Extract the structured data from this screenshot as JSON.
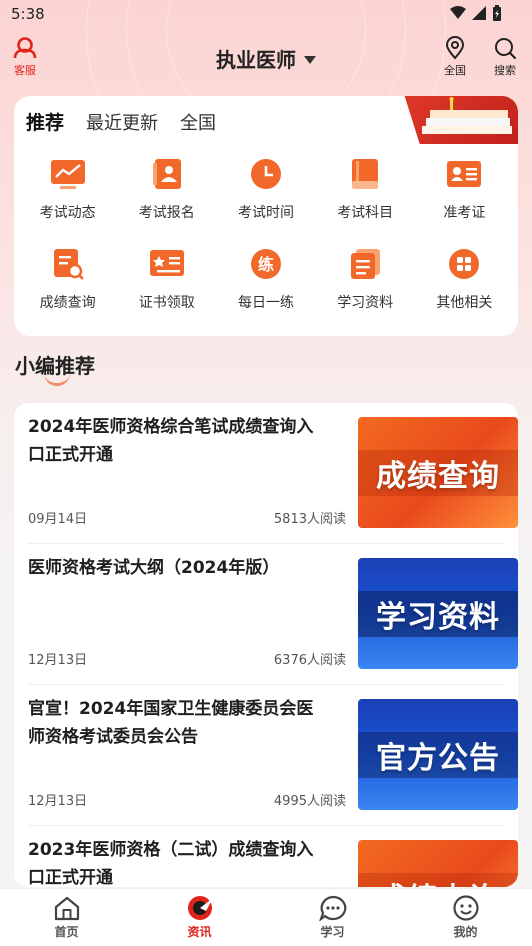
{
  "status_bar": {
    "time": "5:38"
  },
  "header": {
    "service_label": "客服",
    "title": "执业医师",
    "region_label": "全国",
    "search_label": "搜索"
  },
  "tabs": [
    {
      "label": "推荐",
      "active": true
    },
    {
      "label": "最近更新",
      "active": false
    },
    {
      "label": "全国",
      "active": false
    }
  ],
  "grid": [
    {
      "label": "考试动态",
      "icon": "trend-icon"
    },
    {
      "label": "考试报名",
      "icon": "signup-icon"
    },
    {
      "label": "考试时间",
      "icon": "clock-icon"
    },
    {
      "label": "考试科目",
      "icon": "book-icon"
    },
    {
      "label": "准考证",
      "icon": "id-card-icon"
    },
    {
      "label": "成绩查询",
      "icon": "score-search-icon"
    },
    {
      "label": "证书领取",
      "icon": "certificate-icon"
    },
    {
      "label": "每日一练",
      "icon": "practice-icon",
      "glyph": "练"
    },
    {
      "label": "学习资料",
      "icon": "materials-icon"
    },
    {
      "label": "其他相关",
      "icon": "grid-icon"
    }
  ],
  "section_title": "小编推荐",
  "news": [
    {
      "title": "2024年医师资格综合笔试成绩查询入口正式开通",
      "date": "09月14日",
      "reads": "5813人阅读",
      "thumb_text": "成绩查询",
      "thumb_style": "orange"
    },
    {
      "title": "医师资格考试大纲（2024年版）",
      "date": "12月13日",
      "reads": "6376人阅读",
      "thumb_text": "学习资料",
      "thumb_style": "blue"
    },
    {
      "title": "官宣！2024年国家卫生健康委员会医师资格考试委员会公告",
      "date": "12月13日",
      "reads": "4995人阅读",
      "thumb_text": "官方公告",
      "thumb_style": "blue"
    },
    {
      "title": "2023年医师资格（二试）成绩查询入口正式开通",
      "date": "",
      "reads": "",
      "thumb_text": "成绩查询",
      "thumb_style": "orange"
    }
  ],
  "bottom_nav": [
    {
      "label": "首页",
      "icon": "home-icon",
      "active": false
    },
    {
      "label": "资讯",
      "icon": "news-icon",
      "active": true
    },
    {
      "label": "学习",
      "icon": "chat-icon",
      "active": false
    },
    {
      "label": "我的",
      "icon": "smile-icon",
      "active": false
    }
  ],
  "colors": {
    "accent": "#e1241b",
    "orange": "#f2672a",
    "bg_pink": "#fbd4d2"
  }
}
